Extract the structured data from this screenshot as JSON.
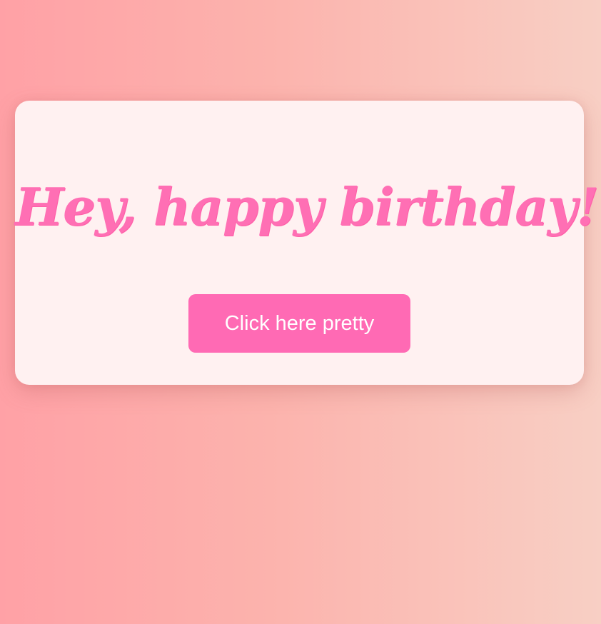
{
  "card": {
    "headline": "Hey, happy birthday!",
    "button_label": "Click here pretty"
  },
  "colors": {
    "background_start": "#ffa1a6",
    "background_end": "#f8cfc4",
    "card": "#fff1f1",
    "accent": "#ff6ab4"
  }
}
